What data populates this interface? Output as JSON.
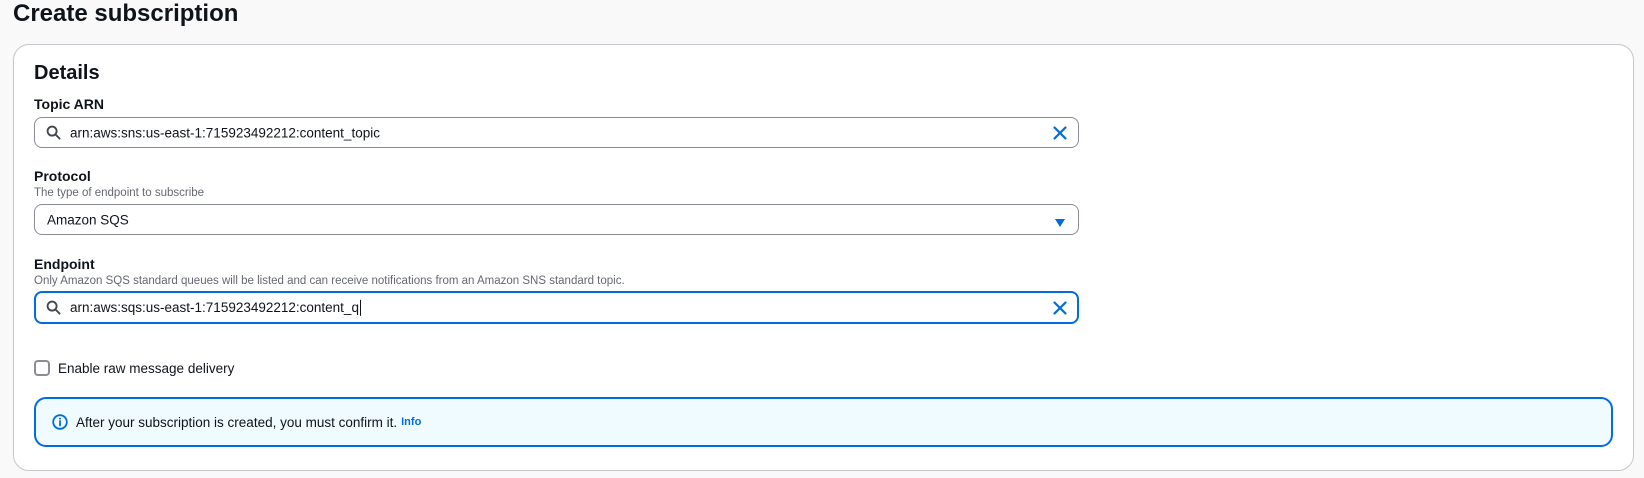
{
  "page": {
    "title": "Create subscription"
  },
  "details": {
    "header": "Details",
    "topic_arn": {
      "label": "Topic ARN",
      "value": "arn:aws:sns:us-east-1:715923492212:content_topic",
      "icon": "search-icon",
      "clear_icon": "close-icon"
    },
    "protocol": {
      "label": "Protocol",
      "description": "The type of endpoint to subscribe",
      "selected": "Amazon SQS",
      "icon": "caret-down-icon"
    },
    "endpoint": {
      "label": "Endpoint",
      "description": "Only Amazon SQS standard queues will be listed and can receive notifications from an Amazon SNS standard topic.",
      "value": "arn:aws:sqs:us-east-1:715923492212:content_q",
      "icon": "search-icon",
      "clear_icon": "close-icon"
    },
    "raw_delivery": {
      "label": "Enable raw message delivery",
      "checked": false
    },
    "alert": {
      "message": "After your subscription is created, you must confirm it.",
      "link": "Info",
      "icon": "info-icon"
    }
  },
  "colors": {
    "accent": "#006ce0",
    "alert_bg": "#f0fbff",
    "border": "#8c8c94",
    "text": "#0f141a",
    "muted_text": "#656871"
  }
}
